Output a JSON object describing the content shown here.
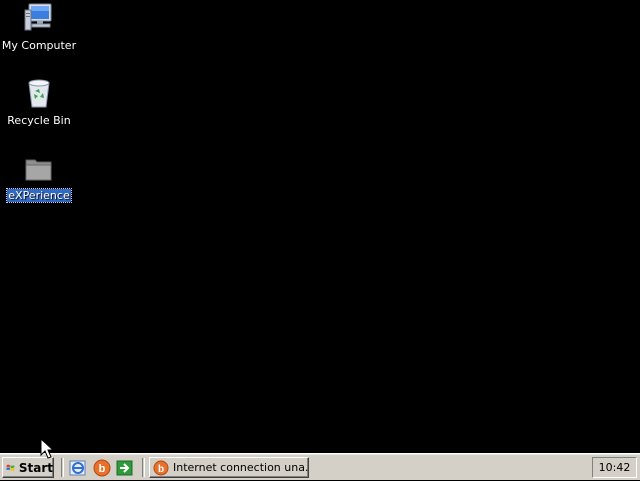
{
  "desktop": {
    "icons": [
      {
        "label": "My Computer",
        "icon": "my-computer-icon"
      },
      {
        "label": "Recycle Bin",
        "icon": "recycle-bin-icon"
      },
      {
        "label": "eXPerience",
        "icon": "folder-icon",
        "selected": true
      }
    ]
  },
  "taskbar": {
    "start_label": "Start",
    "quick_launch": [
      {
        "icon": "internet-explorer-icon"
      },
      {
        "icon": "browser-icon"
      },
      {
        "icon": "show-desktop-arrow-icon"
      }
    ],
    "task_button_label": "Internet connection una...",
    "clock": "10:42"
  },
  "colors": {
    "desktop_background": "#000000",
    "taskbar": "#d4d0c8",
    "selection": "#316ac5"
  }
}
